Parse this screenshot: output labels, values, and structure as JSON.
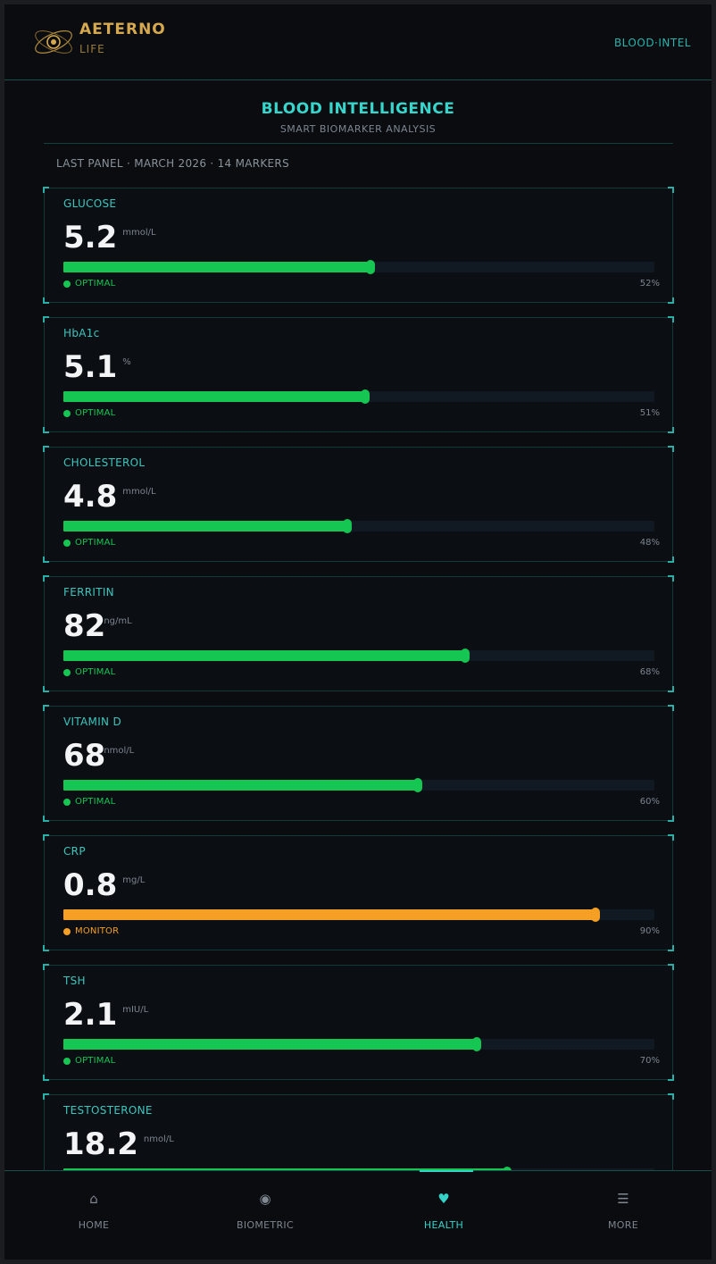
{
  "app": {
    "brand_name": "AETERNO",
    "brand_sub": "LIFE",
    "header_link": "BLOOD·INTEL"
  },
  "page": {
    "title": "BLOOD INTELLIGENCE",
    "subtitle": "SMART BIOMARKER ANALYSIS",
    "panel_info": "LAST PANEL · MARCH 2026 · 14 MARKERS"
  },
  "colors": {
    "accent": "#35d2c8",
    "brand": "#d6a94f",
    "optimal": "#16c653",
    "monitor": "#f5a024"
  },
  "markers": [
    {
      "name": "GLUCOSE",
      "value": "5.2",
      "unit": "mmol/L",
      "percent": 52,
      "pct_label": "52%",
      "status": "OPTIMAL",
      "status_color": "#16c653"
    },
    {
      "name": "HbA1c",
      "value": "5.1",
      "unit": "%",
      "percent": 51,
      "pct_label": "51%",
      "status": "OPTIMAL",
      "status_color": "#16c653"
    },
    {
      "name": "CHOLESTEROL",
      "value": "4.8",
      "unit": "mmol/L",
      "percent": 48,
      "pct_label": "48%",
      "status": "OPTIMAL",
      "status_color": "#16c653"
    },
    {
      "name": "FERRITIN",
      "value": "82",
      "unit": "ng/mL",
      "percent": 68,
      "pct_label": "68%",
      "status": "OPTIMAL",
      "status_color": "#16c653"
    },
    {
      "name": "VITAMIN D",
      "value": "68",
      "unit": "nmol/L",
      "percent": 60,
      "pct_label": "60%",
      "status": "OPTIMAL",
      "status_color": "#16c653"
    },
    {
      "name": "CRP",
      "value": "0.8",
      "unit": "mg/L",
      "percent": 90,
      "pct_label": "90%",
      "status": "MONITOR",
      "status_color": "#f5a024"
    },
    {
      "name": "TSH",
      "value": "2.1",
      "unit": "mIU/L",
      "percent": 70,
      "pct_label": "70%",
      "status": "OPTIMAL",
      "status_color": "#16c653"
    },
    {
      "name": "TESTOSTERONE",
      "value": "18.2",
      "unit": "nmol/L",
      "percent": 75,
      "pct_label": "",
      "status": "",
      "status_color": "#16c653"
    }
  ],
  "nav": [
    {
      "label": "HOME",
      "icon": "home-icon",
      "glyph": "⌂",
      "active": false
    },
    {
      "label": "BIOMETRIC",
      "icon": "biometric-icon",
      "glyph": "◉",
      "active": false
    },
    {
      "label": "HEALTH",
      "icon": "heart-icon",
      "glyph": "♥",
      "active": true
    },
    {
      "label": "MORE",
      "icon": "menu-icon",
      "glyph": "☰",
      "active": false
    }
  ]
}
